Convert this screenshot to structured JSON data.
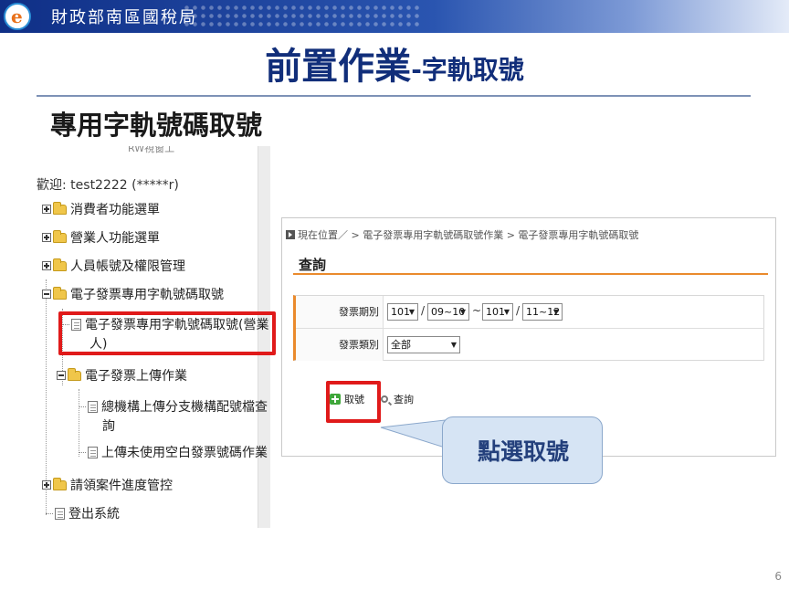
{
  "banner": {
    "agency": "財政部南區國稅局",
    "logo_letter": "e"
  },
  "title": {
    "main": "前置作業",
    "suffix": "-字軌取號"
  },
  "subtitle": "專用字軌號碼取號",
  "sidebar": {
    "cutoff_text": "RW視窗工",
    "welcome": "歡迎: test2222 (*****r)",
    "items": [
      {
        "label": "消費者功能選單"
      },
      {
        "label": "營業人功能選單"
      },
      {
        "label": "人員帳號及權限管理"
      },
      {
        "label": "電子發票專用字軌號碼取號"
      },
      {
        "label": "電子發票專用字軌號碼取號(營業",
        "label_line2": "人)"
      },
      {
        "label": "電子發票上傳作業"
      },
      {
        "label": "總機構上傳分支機構配號檔查",
        "label_line2": "詢"
      },
      {
        "label": "上傳未使用空白發票號碼作業"
      },
      {
        "label": "請領案件進度管控"
      },
      {
        "label": "登出系統"
      }
    ]
  },
  "panel": {
    "breadcrumb": "現在位置／ > 電子發票專用字軌號碼取號作業 > 電子發票專用字軌號碼取號",
    "title": "查詢",
    "period_label": "發票期別",
    "period": {
      "year_from": "101",
      "sep1": "/",
      "month_from": "09~10",
      "tilde": "~",
      "year_to": "101",
      "sep2": "/",
      "month_to": "11~12"
    },
    "type_label": "發票類別",
    "type_value": "全部",
    "get_number_button": "取號",
    "query_button": "查詢"
  },
  "callout": "點選取號",
  "page_number": "6",
  "colors": {
    "banner_start": "#0f2f86",
    "title": "#112e7a",
    "highlight": "#e01a1a",
    "accent": "#ea8a2c",
    "callout_bg": "#d6e4f4"
  },
  "icons": [
    "logo-icon",
    "expand-icon",
    "collapse-icon",
    "folder-icon",
    "folder-open-icon",
    "document-icon",
    "breadcrumb-arrow-icon",
    "dropdown-arrow-icon",
    "add-icon",
    "search-icon"
  ]
}
